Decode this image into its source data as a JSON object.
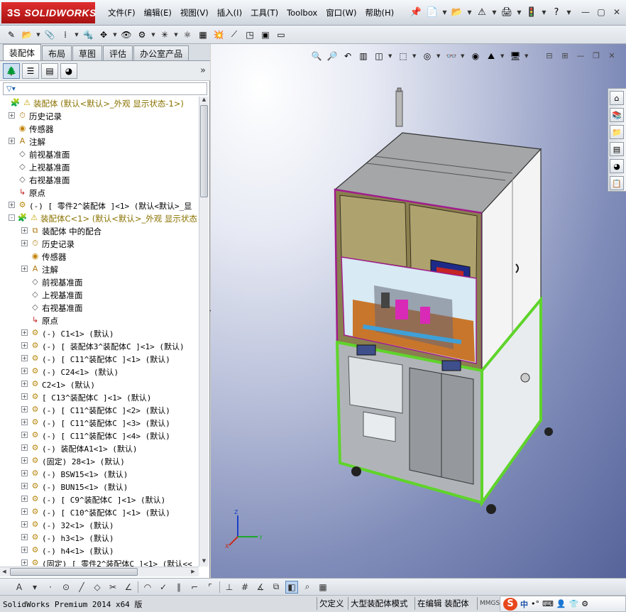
{
  "app": {
    "brand": "SOLIDWORKS",
    "brand_prefix": "3S"
  },
  "menu": [
    "文件(F)",
    "编辑(E)",
    "视图(V)",
    "插入(I)",
    "工具(T)",
    "Toolbox",
    "窗口(W)",
    "帮助(H)"
  ],
  "tabs": [
    "装配体",
    "布局",
    "草图",
    "评估",
    "办公室产品"
  ],
  "tree": [
    {
      "label": "装配体  (默认<默认>_外观 显示状态-1>)",
      "indent": 0,
      "expander": "",
      "icon": "assembly-icon",
      "warning": true,
      "color": "yellow"
    },
    {
      "label": "历史记录",
      "indent": 1,
      "expander": "+",
      "icon": "history-icon"
    },
    {
      "label": "传感器",
      "indent": 1,
      "expander": "",
      "icon": "sensor-icon"
    },
    {
      "label": "注解",
      "indent": 1,
      "expander": "+",
      "icon": "annotation-icon"
    },
    {
      "label": "前视基准面",
      "indent": 1,
      "expander": "",
      "icon": "plane-icon"
    },
    {
      "label": "上视基准面",
      "indent": 1,
      "expander": "",
      "icon": "plane-icon"
    },
    {
      "label": "右视基准面",
      "indent": 1,
      "expander": "",
      "icon": "plane-icon"
    },
    {
      "label": "原点",
      "indent": 1,
      "expander": "",
      "icon": "origin-icon"
    },
    {
      "label": "(-) [ 零件2^装配体 ]<1> (默认<默认>_显",
      "indent": 1,
      "expander": "+",
      "icon": "part-icon",
      "mono": true
    },
    {
      "label": "装配体C<1> (默认<默认>_外观 显示状态",
      "indent": 1,
      "expander": "-",
      "icon": "assembly-icon",
      "warning": true,
      "color": "yellow"
    },
    {
      "label": "装配体 中的配合",
      "indent": 2,
      "expander": "+",
      "icon": "mate-icon"
    },
    {
      "label": "历史记录",
      "indent": 2,
      "expander": "+",
      "icon": "history-icon"
    },
    {
      "label": "传感器",
      "indent": 2,
      "expander": "",
      "icon": "sensor-icon"
    },
    {
      "label": "注解",
      "indent": 2,
      "expander": "+",
      "icon": "annotation-icon"
    },
    {
      "label": "前视基准面",
      "indent": 2,
      "expander": "",
      "icon": "plane-icon"
    },
    {
      "label": "上视基准面",
      "indent": 2,
      "expander": "",
      "icon": "plane-icon"
    },
    {
      "label": "右视基准面",
      "indent": 2,
      "expander": "",
      "icon": "plane-icon"
    },
    {
      "label": "原点",
      "indent": 2,
      "expander": "",
      "icon": "origin-icon"
    },
    {
      "label": "(-) C1<1> (默认)",
      "indent": 2,
      "expander": "+",
      "icon": "part-icon",
      "mono": true
    },
    {
      "label": "(-) [ 装配体3^装配体C ]<1> (默认)",
      "indent": 2,
      "expander": "+",
      "icon": "part-icon",
      "mono": true
    },
    {
      "label": "(-) [ C11^装配体C ]<1> (默认)",
      "indent": 2,
      "expander": "+",
      "icon": "part-icon",
      "mono": true
    },
    {
      "label": "(-) C24<1> (默认)",
      "indent": 2,
      "expander": "+",
      "icon": "part-icon",
      "mono": true
    },
    {
      "label": "C2<1> (默认)",
      "indent": 2,
      "expander": "+",
      "icon": "part-icon",
      "mono": true
    },
    {
      "label": "[ C13^装配体C ]<1> (默认)",
      "indent": 2,
      "expander": "+",
      "icon": "part-icon",
      "mono": true
    },
    {
      "label": "(-) [ C11^装配体C ]<2> (默认)",
      "indent": 2,
      "expander": "+",
      "icon": "part-icon",
      "mono": true
    },
    {
      "label": "(-) [ C11^装配体C ]<3> (默认)",
      "indent": 2,
      "expander": "+",
      "icon": "part-icon",
      "mono": true
    },
    {
      "label": "(-) [ C11^装配体C ]<4> (默认)",
      "indent": 2,
      "expander": "+",
      "icon": "part-icon",
      "mono": true
    },
    {
      "label": "(-) 装配体A1<1> (默认)",
      "indent": 2,
      "expander": "+",
      "icon": "part-icon",
      "mono": true
    },
    {
      "label": "(固定) 28<1> (默认)",
      "indent": 2,
      "expander": "+",
      "icon": "part-icon",
      "mono": true
    },
    {
      "label": "(-) BSW15<1> (默认)",
      "indent": 2,
      "expander": "+",
      "icon": "part-icon",
      "mono": true
    },
    {
      "label": "(-) BUN15<1> (默认)",
      "indent": 2,
      "expander": "+",
      "icon": "part-icon",
      "mono": true
    },
    {
      "label": "(-) [ C9^装配体C ]<1> (默认)",
      "indent": 2,
      "expander": "+",
      "icon": "part-icon",
      "mono": true
    },
    {
      "label": "(-) [ C10^装配体C ]<1> (默认)",
      "indent": 2,
      "expander": "+",
      "icon": "part-icon",
      "mono": true
    },
    {
      "label": "(-) 32<1> (默认)",
      "indent": 2,
      "expander": "+",
      "icon": "part-icon",
      "mono": true
    },
    {
      "label": "(-) h3<1> (默认)",
      "indent": 2,
      "expander": "+",
      "icon": "part-icon",
      "mono": true
    },
    {
      "label": "(-) h4<1> (默认)",
      "indent": 2,
      "expander": "+",
      "icon": "part-icon",
      "mono": true
    },
    {
      "label": "(固定) [ 零件2^装配体C ]<1> (默认<<",
      "indent": 2,
      "expander": "+",
      "icon": "part-icon",
      "mono": true
    }
  ],
  "status": {
    "app_version": "SolidWorks Premium 2014 x64 版",
    "definition": "欠定义",
    "large_assembly": "大型装配体模式",
    "editing": "在编辑 装配体",
    "units": "MMGS"
  },
  "ime": {
    "logo": "S",
    "mode": "中"
  },
  "colors": {
    "accent": "#e03030",
    "tree_warning": "#c8a200",
    "frame_green": "#5fd42a",
    "frame_gray": "#a0a4a8"
  }
}
